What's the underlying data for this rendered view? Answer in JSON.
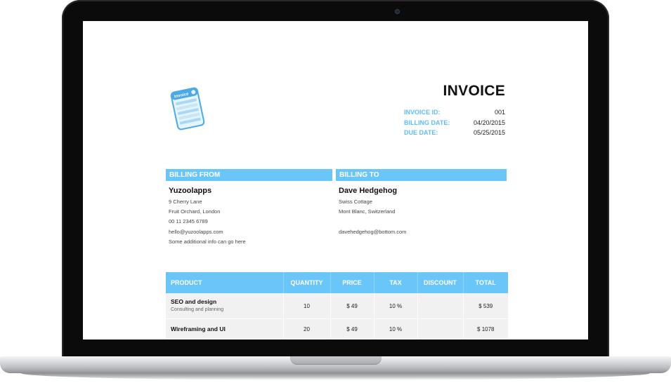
{
  "invoice": {
    "title": "INVOICE",
    "logo_text": "Invoice",
    "meta": [
      {
        "label": "INVOICE ID:",
        "value": "001"
      },
      {
        "label": "BILLING DATE:",
        "value": "04/20/2015"
      },
      {
        "label": "DUE DATE:",
        "value": "05/25/2015"
      }
    ]
  },
  "billing_from": {
    "heading": "BILLING FROM",
    "name": "Yuzoolapps",
    "lines": [
      "9 Cherry Lane",
      "Fruit Orchard, London",
      "00 11 2345 6789",
      "hello@yuzoolapps.com",
      "Some additional info can go here"
    ]
  },
  "billing_to": {
    "heading": "BILLING TO",
    "name": "Dave Hedgehog",
    "lines": [
      "Swiss Cottage",
      "Mont Blanc, Switzerland",
      "",
      "davehedgehog@bottom.com"
    ]
  },
  "items_table": {
    "headers": [
      "PRODUCT",
      "QUANTITY",
      "PRICE",
      "TAX",
      "DISCOUNT",
      "TOTAL"
    ],
    "rows": [
      {
        "product": "SEO and design",
        "description": "Consulting and planning",
        "quantity": "10",
        "price": "$ 49",
        "tax": "10 %",
        "discount": "",
        "total": "$ 539"
      },
      {
        "product": "Wireframing and UI",
        "description": "",
        "quantity": "20",
        "price": "$ 49",
        "tax": "10 %",
        "discount": "",
        "total": "$ 1078"
      }
    ]
  },
  "colors": {
    "accent": "#6ac6f8",
    "label": "#5fbdf5",
    "row_bg": "#f1f1f1"
  }
}
